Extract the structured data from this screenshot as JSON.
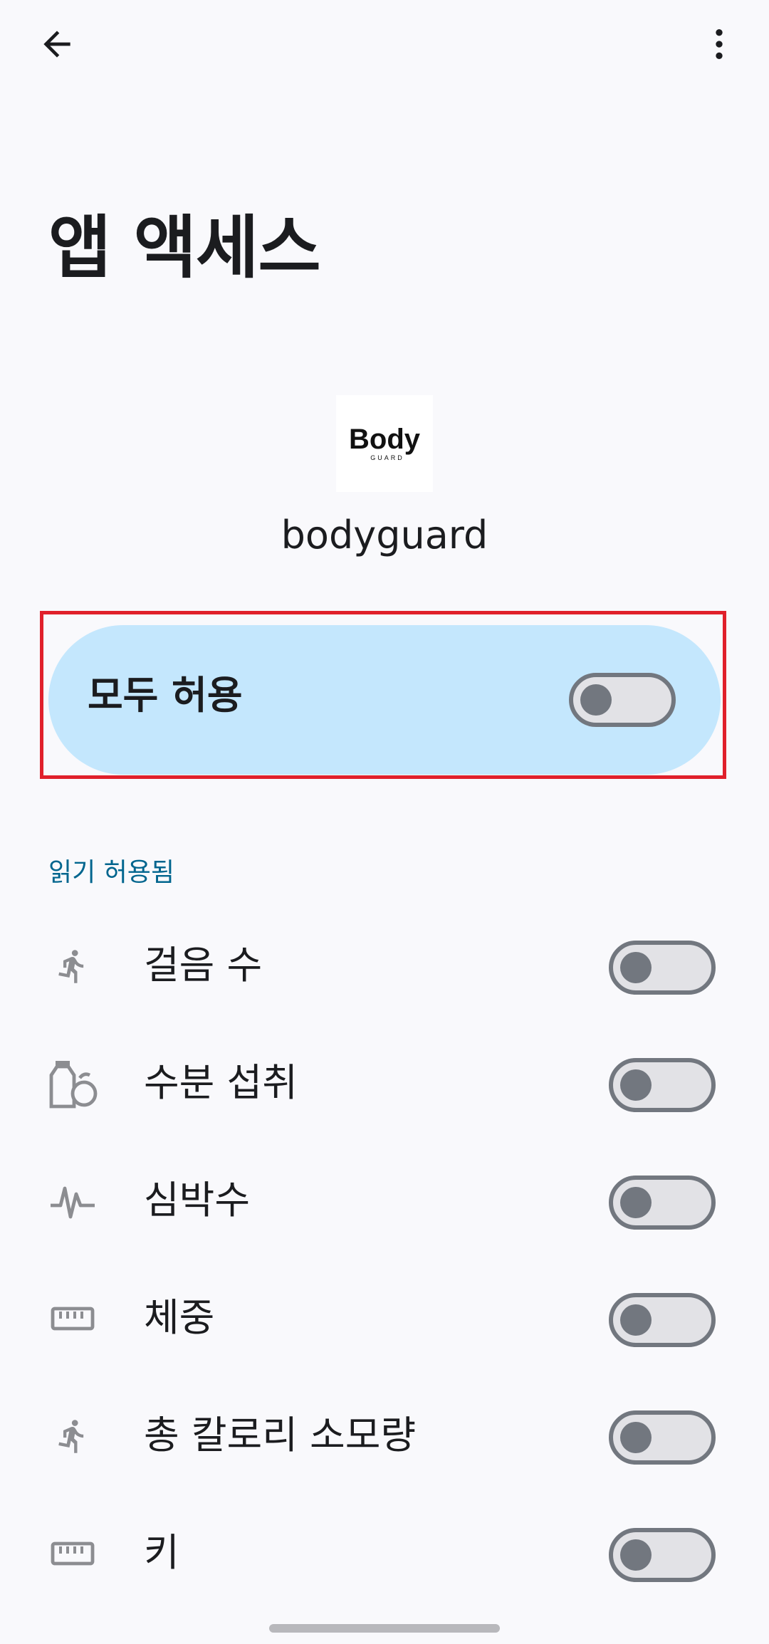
{
  "header": {
    "back_icon": "arrow-back-icon",
    "more_icon": "more-vert-icon"
  },
  "title": "앱 액세스",
  "app": {
    "logo_text_main": "Body",
    "logo_text_sub": "GUARD",
    "name": "bodyguard"
  },
  "allow_all": {
    "label": "모두 허용",
    "enabled": false
  },
  "section": {
    "header": "읽기 허용됨"
  },
  "permissions": [
    {
      "label": "걸음 수",
      "icon": "running-icon",
      "enabled": false
    },
    {
      "label": "수분 섭취",
      "icon": "hydration-icon",
      "enabled": false
    },
    {
      "label": "심박수",
      "icon": "heart-rate-icon",
      "enabled": false
    },
    {
      "label": "체중",
      "icon": "ruler-icon",
      "enabled": false
    },
    {
      "label": "총 칼로리 소모량",
      "icon": "running-icon",
      "enabled": false
    },
    {
      "label": "키",
      "icon": "ruler-icon",
      "enabled": false
    }
  ],
  "colors": {
    "background": "#f9f9fc",
    "accent": "#00658e",
    "card": "#c4e7fd",
    "highlight": "#e0202b",
    "switch_track": "#e2e2e6",
    "switch_outline": "#72777f"
  }
}
